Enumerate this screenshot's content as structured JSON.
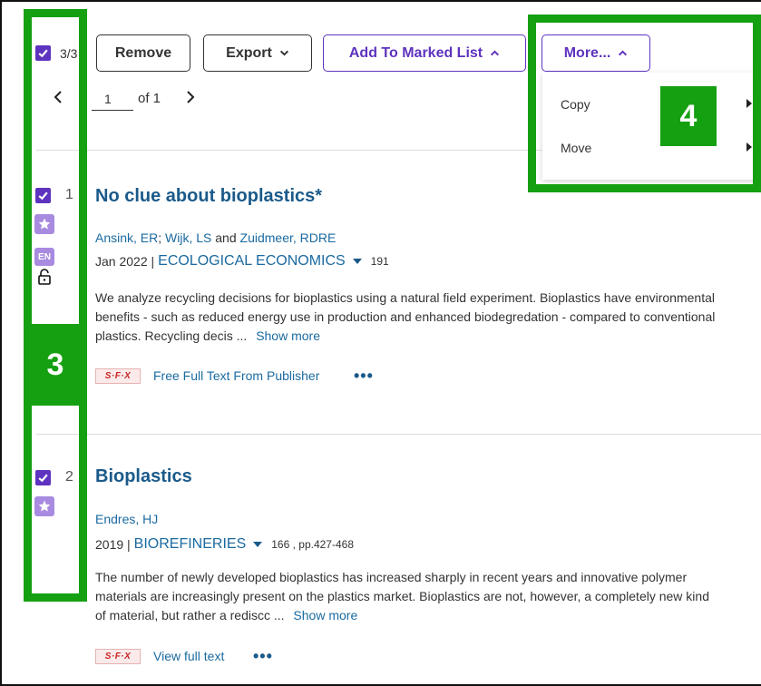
{
  "toolbar": {
    "selected_count": "3/3",
    "remove_label": "Remove",
    "export_label": "Export",
    "add_marked_label": "Add To Marked List",
    "more_label": "More...",
    "page_value": "1",
    "page_of": "of 1"
  },
  "more_menu": {
    "items": [
      {
        "label": "Copy"
      },
      {
        "label": "Move"
      }
    ]
  },
  "annotations": {
    "box3": "3",
    "box4": "4"
  },
  "records": [
    {
      "number": "1",
      "language": "EN",
      "title": "No clue about bioplastics*",
      "authors": [
        "Ansink, ER",
        "Wijk, LS",
        "Zuidmeer, RDRE"
      ],
      "author_sep": ";",
      "author_and": "and",
      "date": "Jan 2022 |",
      "journal": "ECOLOGICAL ECONOMICS",
      "volume": "191",
      "abstract": "We analyze recycling decisions for bioplastics using a natural field experiment. Bioplastics have environmental benefits - such as reduced energy use in production and enhanced biodegredation - compared to conventional plastics. Recycling decis ...",
      "show_more": "Show more",
      "sfx_label": "S·F·X",
      "fulltext_label": "Free Full Text From Publisher",
      "more_dots": "•••"
    },
    {
      "number": "2",
      "title": "Bioplastics",
      "authors": [
        "Endres, HJ"
      ],
      "date": "2019 |",
      "journal": "BIOREFINERIES",
      "volume": "166 , pp.427-468",
      "abstract": "The number of newly developed bioplastics has increased sharply in recent years and innovative polymer materials are increasingly present on the plastics market. Bioplastics are not, however, a completely new kind of material, but rather a rediscc ...",
      "show_more": "Show more",
      "sfx_label": "S·F·X",
      "fulltext_label": "View full text",
      "more_dots": "•••"
    }
  ],
  "colors": {
    "accent": "#5e33bf",
    "badge": "#a88be0",
    "link": "#1a6aa0",
    "annotation_green": "#15a012"
  }
}
